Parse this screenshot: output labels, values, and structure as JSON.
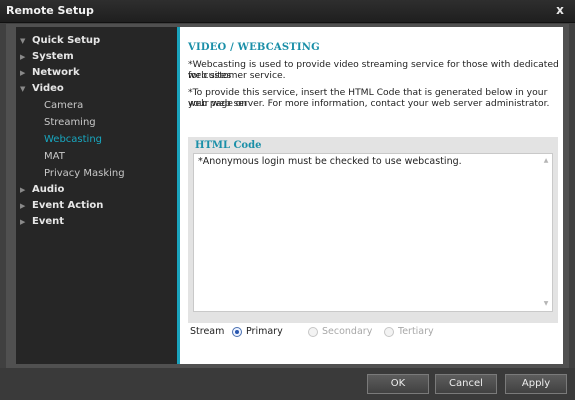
{
  "window": {
    "title": "Remote Setup",
    "close_glyph": "x"
  },
  "sidebar": {
    "items": [
      {
        "label": "Quick Setup",
        "level": "top",
        "state": "expanded"
      },
      {
        "label": "System",
        "level": "top",
        "state": "collapsed"
      },
      {
        "label": "Network",
        "level": "top",
        "state": "collapsed"
      },
      {
        "label": "Video",
        "level": "top",
        "state": "expanded"
      },
      {
        "label": "Camera",
        "level": "child"
      },
      {
        "label": "Streaming",
        "level": "child"
      },
      {
        "label": "Webcasting",
        "level": "child",
        "selected": true
      },
      {
        "label": "MAT",
        "level": "child"
      },
      {
        "label": "Privacy Masking",
        "level": "child"
      },
      {
        "label": "Audio",
        "level": "top",
        "state": "collapsed"
      },
      {
        "label": "Event Action",
        "level": "top",
        "state": "collapsed"
      },
      {
        "label": "Event",
        "level": "top",
        "state": "collapsed"
      }
    ],
    "arrow_expanded": "▼",
    "arrow_collapsed": "▶"
  },
  "panel": {
    "heading": "VIDEO / WEBCASTING",
    "desc1_line1": "*Webcasting is used to provide video streaming service for those with dedicated web sites",
    "desc1_line2": "for customer service.",
    "desc2_line1": "*To provide this service, insert the HTML Code that is generated  below in your web page on",
    "desc2_line2": "your web server. For more information, contact your web server administrator.",
    "html_code_label": "HTML Code",
    "html_code_value": "*Anonymous login must be checked to use webcasting.",
    "stream": {
      "label": "Stream",
      "options": [
        {
          "label": "Primary",
          "selected": true,
          "enabled": true
        },
        {
          "label": "Secondary",
          "selected": false,
          "enabled": false
        },
        {
          "label": "Tertiary",
          "selected": false,
          "enabled": false
        }
      ]
    }
  },
  "footer": {
    "ok_label": "OK",
    "cancel_label": "Cancel",
    "apply_label": "Apply"
  },
  "colors": {
    "accent": "#1aa3bd",
    "sidebar_bg": "#262626",
    "selected_text": "#18a7c0"
  }
}
